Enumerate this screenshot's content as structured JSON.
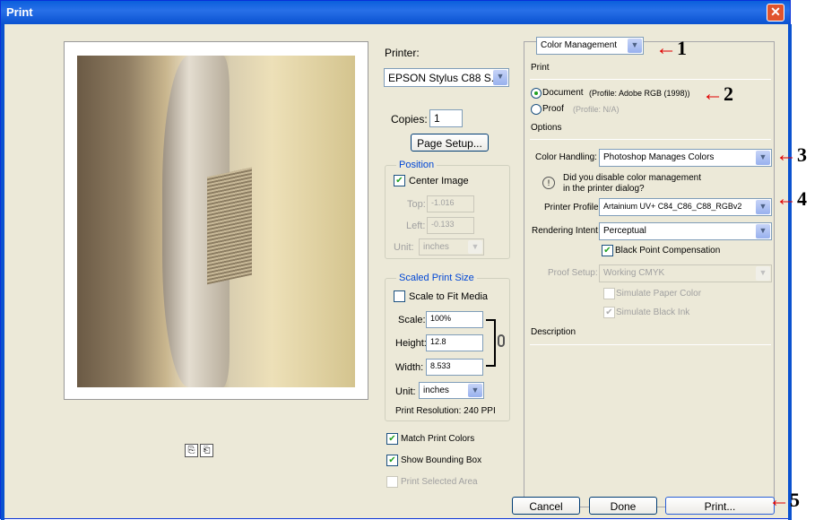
{
  "window": {
    "title": "Print",
    "close_label": "✕"
  },
  "printer": {
    "label": "Printer:",
    "value": "EPSON Stylus C88 S...",
    "copies_label": "Copies:",
    "copies_value": "1",
    "page_setup_label": "Page Setup..."
  },
  "position": {
    "title": "Position",
    "center_image_label": "Center Image",
    "center_image_checked": true,
    "top_label": "Top:",
    "top_value": "-1.016",
    "left_label": "Left:",
    "left_value": "-0.133",
    "unit_label": "Unit:",
    "unit_value": "inches"
  },
  "scaled": {
    "title": "Scaled Print Size",
    "scale_to_fit_label": "Scale to Fit Media",
    "scale_label": "Scale:",
    "scale_value": "100%",
    "height_label": "Height:",
    "height_value": "12.8",
    "width_label": "Width:",
    "width_value": "8.533",
    "unit_label": "Unit:",
    "unit_value": "inches",
    "resolution": "Print Resolution: 240 PPI"
  },
  "options_left": {
    "match_colors_label": "Match Print Colors",
    "bounding_box_label": "Show Bounding Box",
    "selected_area_label": "Print Selected Area"
  },
  "color": {
    "mode_value": "Color Management",
    "print_heading": "Print",
    "document_label": "Document",
    "document_profile": "(Profile: Adobe RGB (1998))",
    "proof_label": "Proof",
    "proof_profile": "(Profile: N/A)",
    "options_heading": "Options",
    "handling_label": "Color Handling:",
    "handling_value": "Photoshop Manages Colors",
    "warning_text_1": "Did you disable color management",
    "warning_text_2": "in the printer dialog?",
    "printer_profile_label": "Printer Profile:",
    "printer_profile_value": "Artainium UV+ C84_C86_C88_RGBv2",
    "rendering_label": "Rendering Intent:",
    "rendering_value": "Perceptual",
    "bpc_label": "Black Point Compensation",
    "proof_setup_label": "Proof Setup:",
    "proof_setup_value": "Working CMYK",
    "simulate_paper_label": "Simulate Paper Color",
    "simulate_ink_label": "Simulate Black Ink",
    "description_heading": "Description"
  },
  "buttons": {
    "cancel": "Cancel",
    "done": "Done",
    "print": "Print..."
  },
  "annotations": {
    "a1": "1",
    "a2": "2",
    "a3": "3",
    "a4": "4",
    "a5": "5",
    "arrow": "←"
  },
  "icons": {
    "arrow_color": "#e00000",
    "check_color": "#21a121",
    "title_bar_color": "#0a52d0"
  }
}
